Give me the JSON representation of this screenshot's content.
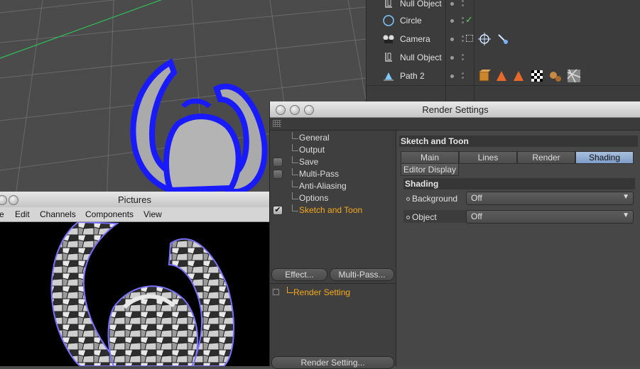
{
  "object_manager": {
    "objects": [
      {
        "label": "Null Object",
        "icon": "null-object-icon"
      },
      {
        "label": "Circle",
        "icon": "circle-spline-icon",
        "checkmark": "✓"
      },
      {
        "label": "Camera",
        "icon": "camera-icon"
      },
      {
        "label": "Null Object",
        "icon": "null-object-icon"
      },
      {
        "label": "Path 2",
        "icon": "path-spline-icon"
      }
    ]
  },
  "pictures": {
    "title": "Pictures",
    "menu": [
      "e",
      "Edit",
      "Channels",
      "Components",
      "View"
    ]
  },
  "render_settings": {
    "title": "Render Settings",
    "nav": [
      {
        "label": "General",
        "checkbox": false,
        "active": false
      },
      {
        "label": "Output",
        "checkbox": false,
        "active": false
      },
      {
        "label": "Save",
        "checkbox": true,
        "active": false
      },
      {
        "label": "Multi-Pass",
        "checkbox": true,
        "active": false
      },
      {
        "label": "Anti-Aliasing",
        "checkbox": false,
        "active": false
      },
      {
        "label": "Options",
        "checkbox": false,
        "active": false
      },
      {
        "label": "Sketch and Toon",
        "checkbox": true,
        "checked": true,
        "active": true
      }
    ],
    "effect_button": "Effect...",
    "multipass_button": "Multi-Pass...",
    "setting_item": "Render Setting",
    "render_setting_button": "Render Setting...",
    "section_title": "Sketch and Toon",
    "tabs": [
      "Main",
      "Lines",
      "Render",
      "Shading"
    ],
    "selected_tab": "Shading",
    "editor_display_tab": "Editor Display",
    "shading_group": "Shading",
    "background_label": "Background",
    "background_value": "Off",
    "object_label": "Object",
    "object_value": "Off",
    "check_mark": "✔"
  },
  "colors": {
    "accent": "#f5a81c",
    "selected_tab": "#8aa8d0",
    "stroke_blue": "#1a1aff"
  }
}
